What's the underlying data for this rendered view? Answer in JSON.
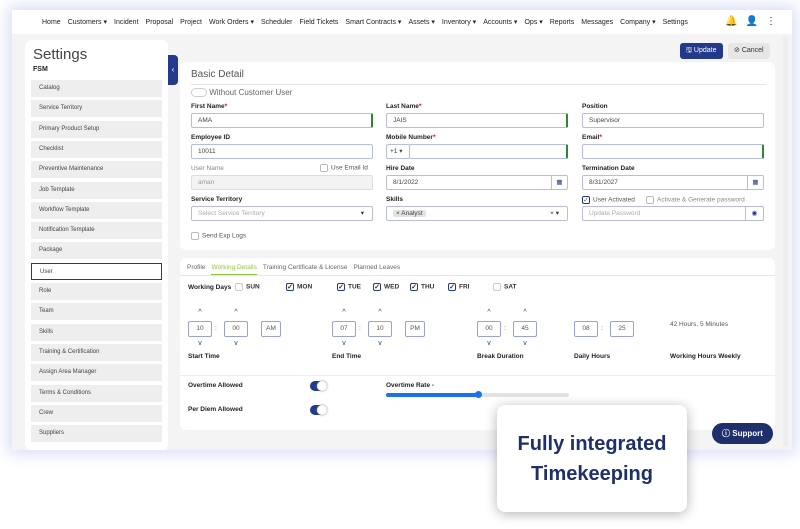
{
  "nav": {
    "items": [
      "Home",
      "Customers ▾",
      "Incident",
      "Proposal",
      "Project",
      "Work Orders ▾",
      "Scheduler",
      "Field Tickets",
      "Smart Contracts ▾",
      "Assets ▾",
      "Inventory ▾",
      "Accounts ▾",
      "Ops ▾",
      "Reports",
      "Messages",
      "Company ▾",
      "Settings"
    ]
  },
  "sidebar": {
    "title": "Settings",
    "section": "FSM",
    "items": [
      "Catalog",
      "Service Territory",
      "Primary Product Setup",
      "Checklist",
      "Preventive Maintenance",
      "Job Template",
      "Workflow Template",
      "Notification Template",
      "Package",
      "User",
      "Role",
      "Team",
      "Skills",
      "Training & Certification",
      "Assign Area Manager",
      "Terms & Conditions",
      "Crew",
      "Suppliers"
    ],
    "selected": "User"
  },
  "actions": {
    "update": "Update",
    "cancel": "Cancel"
  },
  "basic": {
    "title": "Basic Detail",
    "without_customer": "Without Customer User",
    "first_name_label": "First Name",
    "first_name": "AMA",
    "last_name_label": "Last Name",
    "last_name": "JAIS",
    "position_label": "Position",
    "position": "Supervisor",
    "employee_id_label": "Employee ID",
    "employee_id": "10011",
    "mobile_label": "Mobile Number",
    "mobile_code": "+1 ▾",
    "email_label": "Email",
    "username_label": "User Name",
    "use_email": "Use Email Id",
    "username": "aman",
    "hire_label": "Hire Date",
    "hire": "8/1/2022",
    "term_label": "Termination Date",
    "term": "8/31/2027",
    "territory_label": "Service Territory",
    "territory_placeholder": "Select Service Territory",
    "skills_label": "Skills",
    "skill_tag": "Analyst",
    "user_activated": "User Activated",
    "activate_generate": "Activate & Generate password",
    "password_placeholder": "Update Password",
    "send_logs": "Send Exp Logs"
  },
  "tabs": [
    "Profile",
    "Working Details",
    "Training Certificate & License",
    "Planned Leaves"
  ],
  "active_tab": "Working Details",
  "working": {
    "days_label": "Working Days",
    "days": [
      {
        "d": "SUN",
        "on": false
      },
      {
        "d": "MON",
        "on": true
      },
      {
        "d": "TUE",
        "on": true
      },
      {
        "d": "WED",
        "on": true
      },
      {
        "d": "THU",
        "on": true
      },
      {
        "d": "FRI",
        "on": true
      },
      {
        "d": "SAT",
        "on": false
      }
    ],
    "start": {
      "h": "10",
      "m": "00",
      "ampm": "AM",
      "label": "Start Time"
    },
    "end": {
      "h": "07",
      "m": "10",
      "ampm": "PM",
      "label": "End Time"
    },
    "break": {
      "h": "00",
      "m": "45",
      "label": "Break Duration"
    },
    "daily": {
      "h": "08",
      "m": "25",
      "label": "Daily Hours"
    },
    "weekly": {
      "value": "42 Hours, 5 Minutes",
      "label": "Working Hours Weekly"
    },
    "overtime_label": "Overtime Allowed",
    "overtime_on": true,
    "per_diem_label": "Per Diem Allowed",
    "per_diem_on": true,
    "overtime_rate_label": "Overtime Rate -",
    "overtime_rate_percent": 50
  },
  "support": "Support",
  "callout": "Fully integrated Timekeeping",
  "colors": {
    "primary": "#233a8a",
    "accent_green": "#8dc63f",
    "slider": "#1a73e8"
  }
}
